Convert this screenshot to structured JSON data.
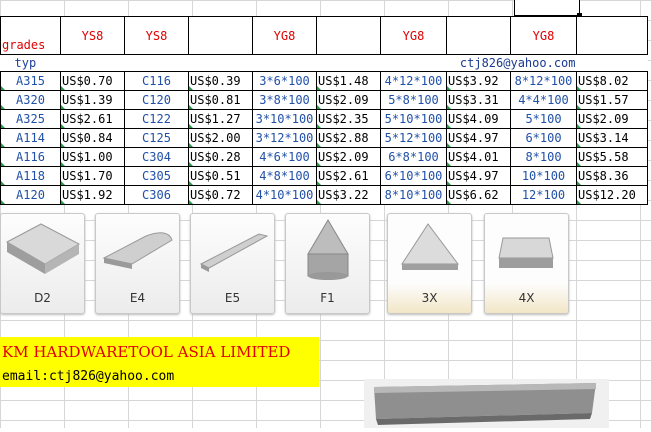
{
  "sheet": {
    "headers": [
      "grades",
      "YS8",
      "YS8",
      "",
      "YG8",
      "",
      "YG8",
      "",
      "YG8",
      ""
    ],
    "typ_label": "typ",
    "email_cell": "ctj826@yahoo.com",
    "rows": [
      [
        "A315",
        "US$0.70",
        "C116",
        "US$0.39",
        "3*6*100",
        "US$1.48",
        "4*12*100",
        "US$3.92",
        "8*12*100",
        "US$8.02"
      ],
      [
        "A320",
        "US$1.39",
        "C120",
        "US$0.81",
        "3*8*100",
        "US$2.09",
        "5*8*100",
        "US$3.31",
        "4*4*100",
        "US$1.57"
      ],
      [
        "A325",
        "US$2.61",
        "C122",
        "US$1.27",
        "3*10*100",
        "US$2.35",
        "5*10*100",
        "US$4.09",
        "5*100",
        "US$2.09"
      ],
      [
        "A114",
        "US$0.84",
        "C125",
        "US$2.00",
        "3*12*100",
        "US$2.88",
        "5*12*100",
        "US$4.97",
        "6*100",
        "US$3.14"
      ],
      [
        "A116",
        "US$1.00",
        "C304",
        "US$0.28",
        "4*6*100",
        "US$2.09",
        "6*8*100",
        "US$4.01",
        "8*100",
        "US$5.58"
      ],
      [
        "A118",
        "US$1.70",
        "C305",
        "US$0.51",
        "4*8*100",
        "US$2.61",
        "6*10*100",
        "US$4.97",
        "10*100",
        "US$8.36"
      ],
      [
        "A120",
        "US$1.92",
        "C306",
        "US$0.72",
        "4*10*100",
        "US$3.22",
        "8*10*100",
        "US$6.62",
        "12*100",
        "US$12.20"
      ]
    ]
  },
  "shapes": [
    {
      "label": "D2",
      "icon": "rectangular-block-icon"
    },
    {
      "label": "E4",
      "icon": "rounded-blade-icon"
    },
    {
      "label": "E5",
      "icon": "angled-blade-icon"
    },
    {
      "label": "F1",
      "icon": "cone-tip-icon"
    },
    {
      "label": "3X",
      "icon": "triangle-insert-icon"
    },
    {
      "label": "4X",
      "icon": "square-insert-icon"
    }
  ],
  "banner": {
    "company": "KM HARDWARETOOL ASIA LIMITED",
    "email": "email:ctj826@yahoo.com"
  },
  "colors": {
    "accent_red": "#e00000",
    "banner_yellow": "#ffff00",
    "code_blue": "#2050a8"
  }
}
